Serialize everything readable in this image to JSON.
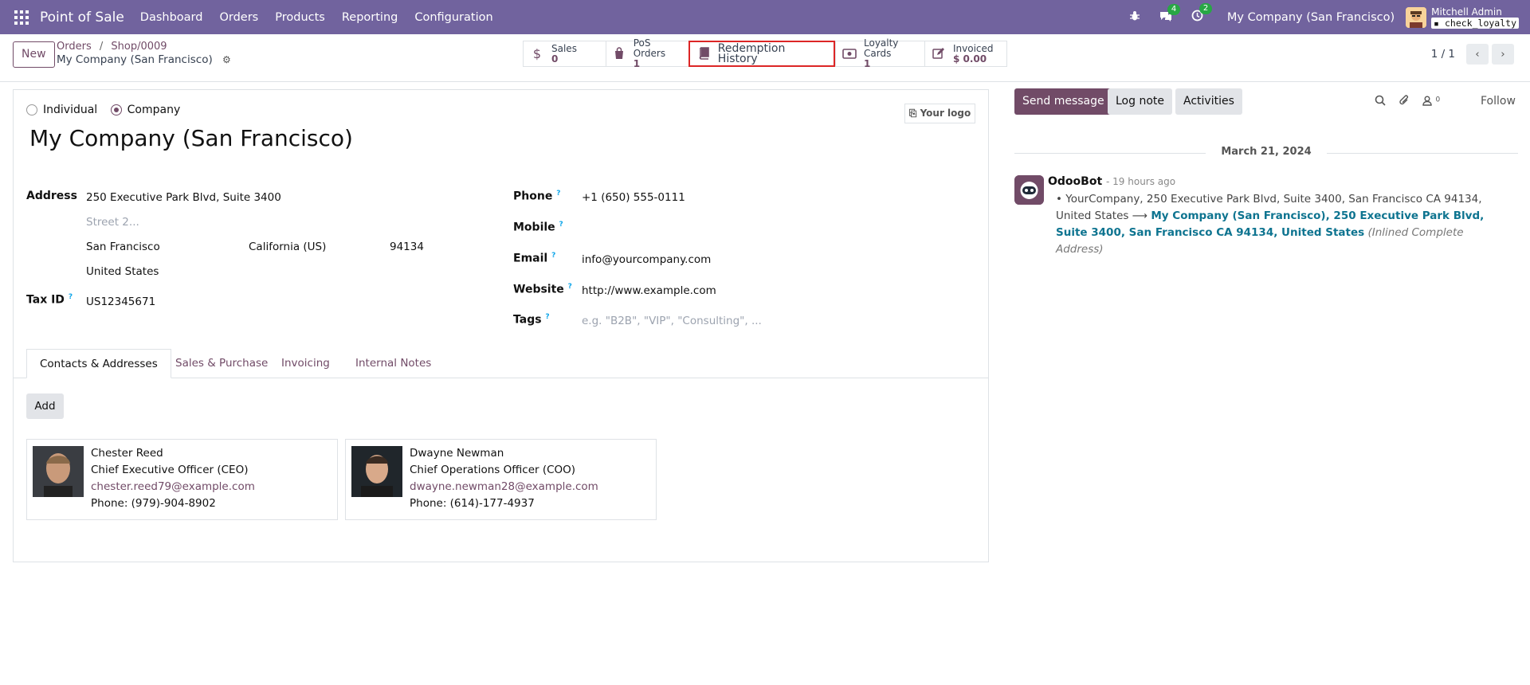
{
  "topbar": {
    "app_name": "Point of Sale",
    "menu": [
      "Dashboard",
      "Orders",
      "Products",
      "Reporting",
      "Configuration"
    ],
    "messages_badge": "4",
    "activities_badge": "2",
    "company": "My Company (San Francisco)",
    "user_name": "Mitchell Admin",
    "database": "check_loyalty",
    "colors": {
      "bar": "#71639e"
    }
  },
  "control_panel": {
    "new_label": "New",
    "breadcrumb": {
      "orders": "Orders",
      "sep": "/",
      "shop": "Shop/0009",
      "current": "My Company (San Francisco)"
    },
    "smart_buttons": {
      "sales": {
        "label": "Sales",
        "value": "0"
      },
      "pos_orders": {
        "label": "PoS Orders",
        "value": "1"
      },
      "redemption": {
        "label": "Redemption History"
      },
      "loyalty": {
        "label": "Loyalty Cards",
        "value": "1"
      },
      "invoiced": {
        "label": "Invoiced",
        "value": "$ 0.00"
      }
    },
    "pager": "1 / 1"
  },
  "form": {
    "type_individual": "Individual",
    "type_company": "Company",
    "logo_button": "Your logo",
    "name": "My Company (San Francisco)",
    "labels": {
      "address": "Address",
      "tax_id": "Tax ID",
      "phone": "Phone",
      "mobile": "Mobile",
      "email": "Email",
      "website": "Website",
      "tags": "Tags"
    },
    "address": {
      "street": "250 Executive Park Blvd, Suite 3400",
      "street2_placeholder": "Street 2...",
      "city": "San Francisco",
      "state": "California (US)",
      "zip": "94134",
      "country": "United States"
    },
    "tax_id": "US12345671",
    "phone": "+1 (650) 555-0111",
    "email": "info@yourcompany.com",
    "website": "http://www.example.com",
    "tags_placeholder": "e.g. \"B2B\", \"VIP\", \"Consulting\", ...",
    "tabs": [
      "Contacts & Addresses",
      "Sales & Purchase",
      "Invoicing",
      "Internal Notes"
    ],
    "add_label": "Add",
    "contacts": [
      {
        "name": "Chester Reed",
        "title": "Chief Executive Officer (CEO)",
        "email": "chester.reed79@example.com",
        "phone": "Phone: (979)-904-8902"
      },
      {
        "name": "Dwayne Newman",
        "title": "Chief Operations Officer (COO)",
        "email": "dwayne.newman28@example.com",
        "phone": "Phone: (614)-177-4937"
      }
    ]
  },
  "chatter": {
    "send_message": "Send message",
    "log_note": "Log note",
    "activities": "Activities",
    "followers_count": "0",
    "follow": "Follow",
    "date": "March 21, 2024",
    "author": "OdooBot",
    "time": "- 19 hours ago",
    "old_value": "YourCompany, 250 Executive Park Blvd, Suite 3400, San Francisco CA 94134, United States",
    "arrow": "⟶",
    "new_value": "My Company (San Francisco), 250 Executive Park Blvd, Suite 3400, San Francisco CA 94134, United States",
    "field_name": "(Inlined Complete Address)"
  }
}
